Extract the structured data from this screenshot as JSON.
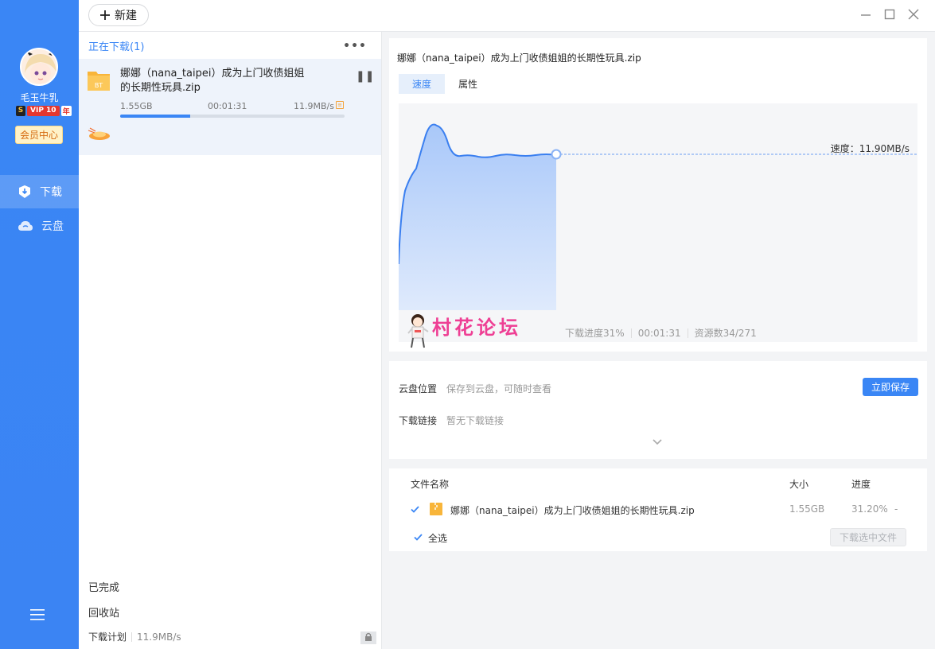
{
  "user": {
    "name": "毛玉牛乳",
    "vip_level": "VIP 10",
    "vip_year": "年",
    "member_center": "会员中心"
  },
  "nav": {
    "download": "下载",
    "cloud": "云盘"
  },
  "toolbar": {
    "new_label": "新建"
  },
  "list": {
    "header": "正在下载(1)",
    "more": "•••",
    "item": {
      "name": "娜娜（nana_taipei）成为上门收债姐姐的长期性玩具.zip",
      "size": "1.55GB",
      "time": "00:01:31",
      "speed": "11.9MB/s",
      "progress": 0.312,
      "icon_text": "BT"
    },
    "finished": "已完成",
    "recycle": "回收站",
    "plan": "下载计划",
    "plan_speed": "11.9MB/s"
  },
  "detail": {
    "title": "娜娜（nana_taipei）成为上门收债姐姐的长期性玩具.zip",
    "tabs": [
      "速度",
      "属性"
    ],
    "speed_label": "速度：11.90MB/s",
    "stats": {
      "progress": "下载进度31%",
      "time": "00:01:31",
      "sources": "资源数34/271"
    },
    "watermark": "村花论坛",
    "cloud_label": "云盘位置",
    "cloud_value": "保存到云盘，可随时查看",
    "save_btn": "立即保存",
    "link_label": "下载链接",
    "link_value": "暂无下载链接"
  },
  "files": {
    "col_name": "文件名称",
    "col_size": "大小",
    "col_progress": "进度",
    "row": {
      "name": "娜娜（nana_taipei）成为上门收债姐姐的长期性玩具.zip",
      "size": "1.55GB",
      "progress": "31.20%",
      "extra": "-"
    },
    "select_all": "全选",
    "download_selected": "下载选中文件"
  },
  "colors": {
    "accent": "#3a86f5",
    "watermark": "#ee3f94"
  }
}
